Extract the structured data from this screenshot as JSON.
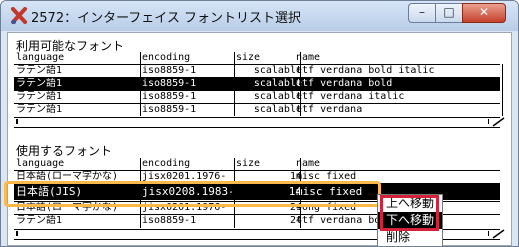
{
  "window": {
    "title": "2572：インターフェイス フォントリスト選択",
    "controls": {
      "minimize": "–",
      "maximize": "□",
      "close": "✕"
    }
  },
  "available": {
    "label": "利用可能なフォント",
    "headers": [
      "language",
      "encoding",
      "size",
      "name"
    ],
    "rows": [
      {
        "language": "ラテン語1",
        "encoding": "iso8859-1",
        "size": "scalable",
        "name": "ttf verdana bold italic"
      },
      {
        "language": "ラテン語1",
        "encoding": "iso8859-1",
        "size": "scalable",
        "name": "ttf verdana bold"
      },
      {
        "language": "ラテン語1",
        "encoding": "iso8859-1",
        "size": "scalable",
        "name": "ttf verdana italic"
      },
      {
        "language": "ラテン語1",
        "encoding": "iso8859-1",
        "size": "scalable",
        "name": "ttf verdana"
      }
    ]
  },
  "used": {
    "label": "使用するフォント",
    "headers": [
      "language",
      "encoding",
      "size",
      "name"
    ],
    "rows": [
      {
        "language": "日本語(ローマ字かな)",
        "encoding": "jisx0201.1976-",
        "size": "14",
        "name": "misc fixed"
      },
      {
        "language": "日本語(JIS)",
        "encoding": "jisx0208.1983-",
        "size": "14",
        "name": "misc fixed"
      },
      {
        "language": "日本語(ローマ字かな)",
        "encoding": "jisx0201.1976-",
        "size": "24",
        "name": "song fixed"
      },
      {
        "language": "ラテン語1",
        "encoding": "iso8859-1",
        "size": "24",
        "name": "ttf verdana bo"
      }
    ]
  },
  "context_menu": {
    "items": [
      "上へ移動",
      "下へ移動",
      "削除"
    ]
  },
  "colors": {
    "selected_bg": "#000000",
    "highlight_border": "#ffb84a",
    "menu_frame": "#d6213a"
  }
}
